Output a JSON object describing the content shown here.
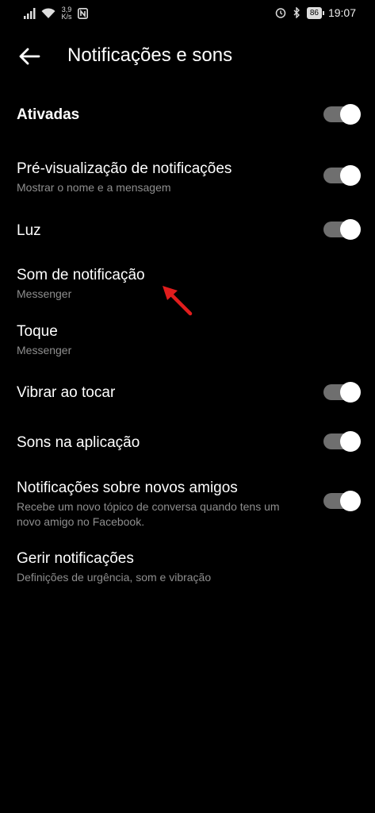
{
  "status_bar": {
    "speed_top": "3,9",
    "speed_bottom": "K/s",
    "battery": "86",
    "time": "19:07"
  },
  "header": {
    "title": "Notificações e sons"
  },
  "settings": [
    {
      "title": "Ativadas",
      "subtitle": "",
      "toggle": true
    },
    {
      "title": "Pré-visualização de notificações",
      "subtitle": "Mostrar o nome e a mensagem",
      "toggle": true
    },
    {
      "title": "Luz",
      "subtitle": "",
      "toggle": true
    },
    {
      "title": "Som de notificação",
      "subtitle": "Messenger",
      "toggle": null
    },
    {
      "title": "Toque",
      "subtitle": "Messenger",
      "toggle": null
    },
    {
      "title": "Vibrar ao tocar",
      "subtitle": "",
      "toggle": true
    },
    {
      "title": "Sons na aplicação",
      "subtitle": "",
      "toggle": true
    },
    {
      "title": "Notificações sobre novos amigos",
      "subtitle": "Recebe um novo tópico de conversa quando tens um novo amigo no Facebook.",
      "toggle": true
    },
    {
      "title": "Gerir notificações",
      "subtitle": "Definições de urgência, som e vibração",
      "toggle": null
    }
  ],
  "colors": {
    "background": "#000000",
    "subtitle": "#8e8e8e",
    "toggle_track": "#6f6f6f",
    "annotation_arrow": "#e11d1d"
  }
}
